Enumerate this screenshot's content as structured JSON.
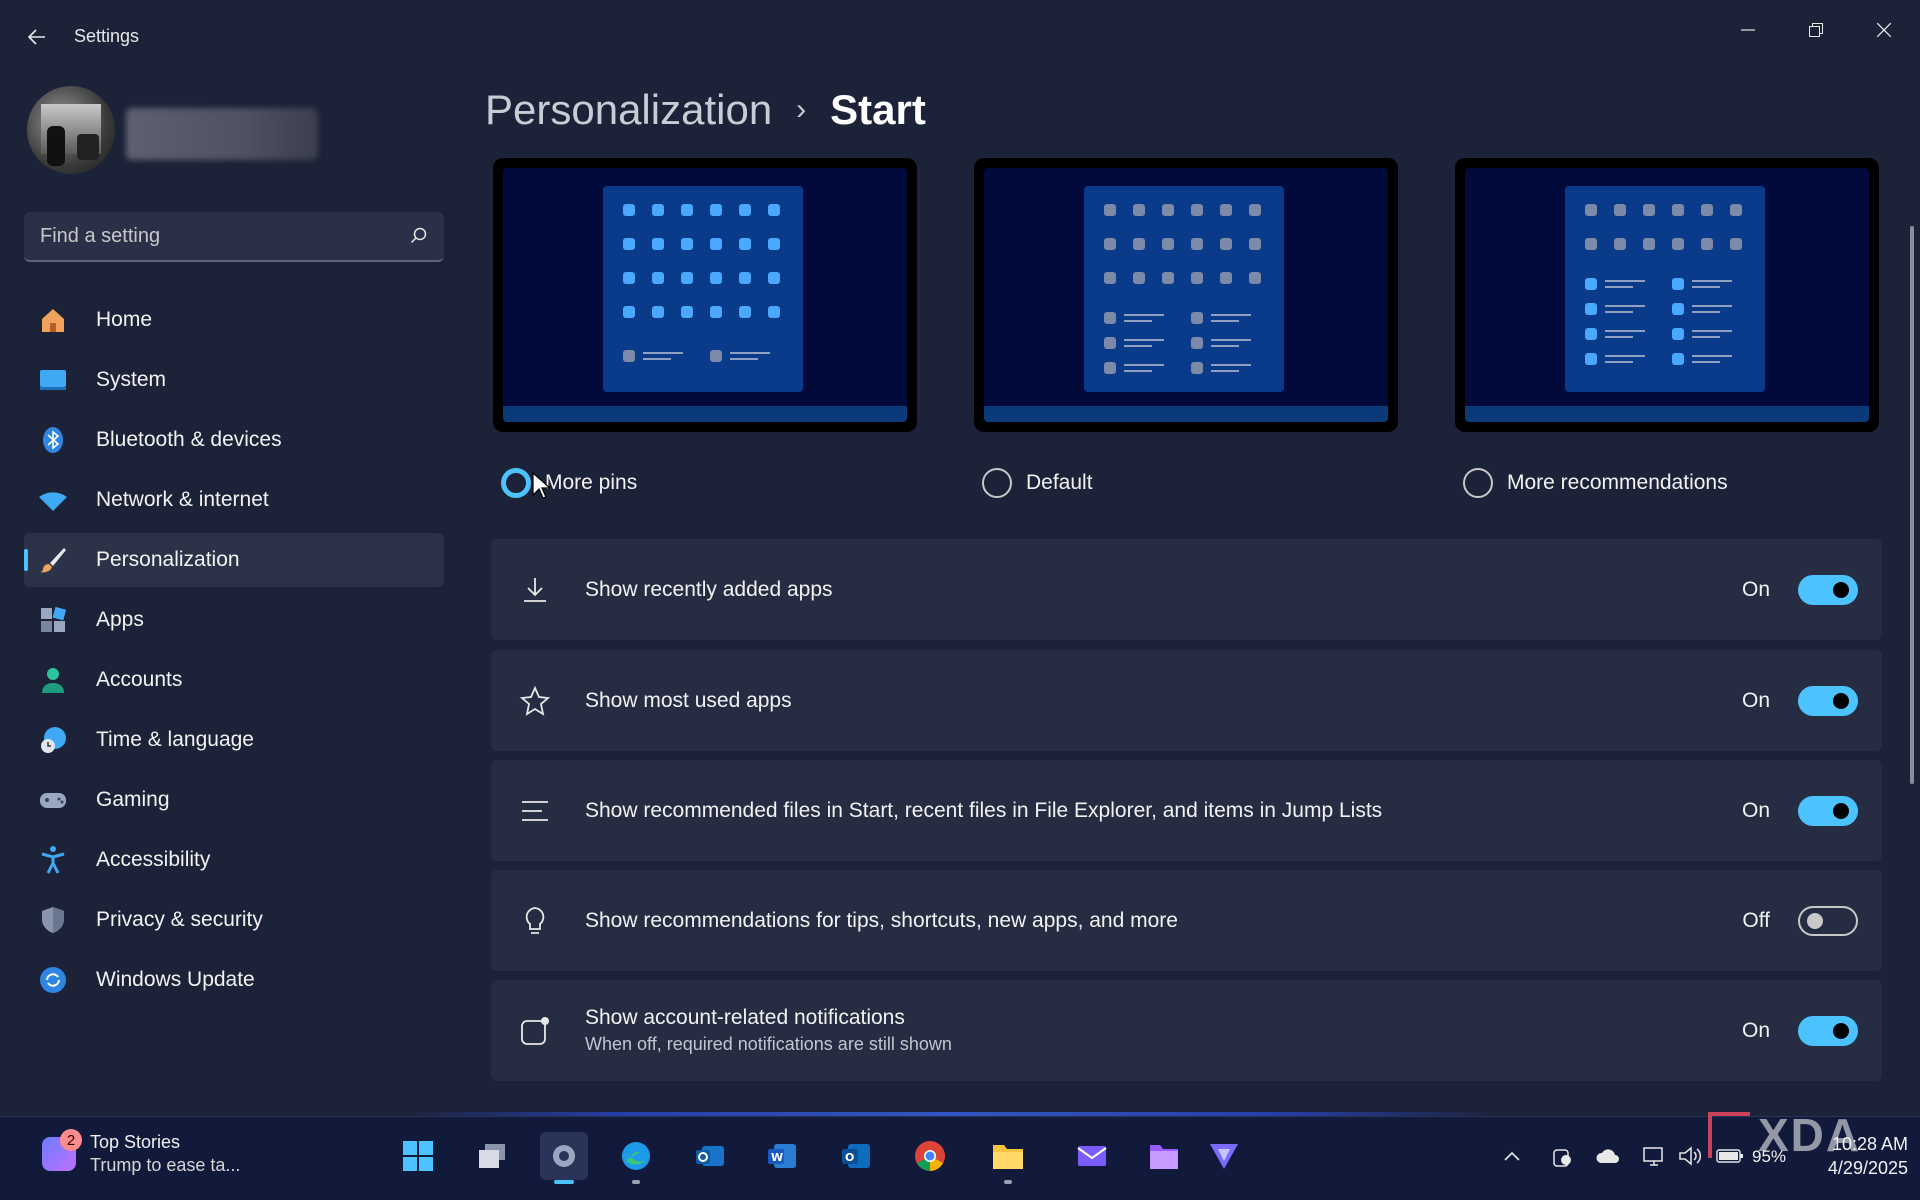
{
  "window": {
    "title": "Settings"
  },
  "search": {
    "placeholder": "Find a setting"
  },
  "sidebar": {
    "items": [
      {
        "label": "Home",
        "icon": "home-icon"
      },
      {
        "label": "System",
        "icon": "system-icon"
      },
      {
        "label": "Bluetooth & devices",
        "icon": "bluetooth-icon"
      },
      {
        "label": "Network & internet",
        "icon": "wifi-icon"
      },
      {
        "label": "Personalization",
        "icon": "brush-icon",
        "active": true
      },
      {
        "label": "Apps",
        "icon": "apps-icon"
      },
      {
        "label": "Accounts",
        "icon": "account-icon"
      },
      {
        "label": "Time & language",
        "icon": "clock-globe-icon"
      },
      {
        "label": "Gaming",
        "icon": "gamepad-icon"
      },
      {
        "label": "Accessibility",
        "icon": "accessibility-icon"
      },
      {
        "label": "Privacy & security",
        "icon": "shield-icon"
      },
      {
        "label": "Windows Update",
        "icon": "update-icon"
      }
    ]
  },
  "breadcrumb": {
    "parent": "Personalization",
    "separator": "›",
    "current": "Start"
  },
  "layouts": [
    {
      "label": "More pins",
      "selected": true
    },
    {
      "label": "Default",
      "selected": false
    },
    {
      "label": "More recommendations",
      "selected": false
    }
  ],
  "settings": [
    {
      "label": "Show recently added apps",
      "sub": "",
      "state": "On",
      "on": true,
      "icon": "download-icon"
    },
    {
      "label": "Show most used apps",
      "sub": "",
      "state": "On",
      "on": true,
      "icon": "star-icon"
    },
    {
      "label": "Show recommended files in Start, recent files in File Explorer, and items in Jump Lists",
      "sub": "",
      "state": "On",
      "on": true,
      "icon": "list-icon"
    },
    {
      "label": "Show recommendations for tips, shortcuts, new apps, and more",
      "sub": "",
      "state": "Off",
      "on": false,
      "icon": "lightbulb-icon"
    },
    {
      "label": "Show account-related notifications",
      "sub": "When off, required notifications are still shown",
      "state": "On",
      "on": true,
      "icon": "notification-icon"
    }
  ],
  "taskbar": {
    "news_title": "Top Stories",
    "news_sub": "Trump to ease ta...",
    "news_badge": "2",
    "battery": "95%",
    "time": "10:28 AM",
    "date": "4/29/2025"
  },
  "watermark": "XDA",
  "colors": {
    "accent": "#4cc2ff",
    "background": "#1c2237",
    "card": "#262d42"
  }
}
